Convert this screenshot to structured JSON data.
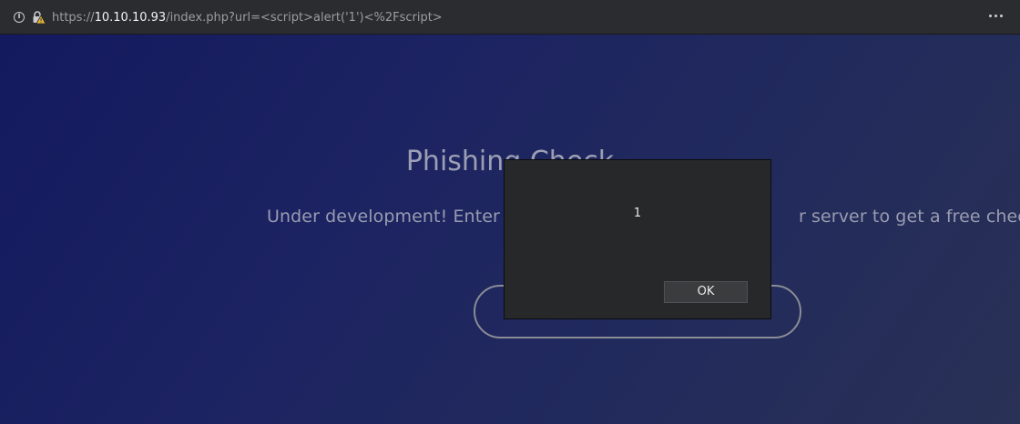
{
  "browser": {
    "url": {
      "scheme": "https://",
      "host": "10.10.10.93",
      "path": "/index.php?url=<script>alert('1')<%2Fscript>"
    },
    "icons": {
      "info": "info-icon",
      "security": "warning-lock-icon",
      "menu": "more-actions-icon"
    }
  },
  "page": {
    "heading": "Phishing Check",
    "subtitle_visible_left": "Under development! Enter",
    "subtitle_visible_right": "r server to get a free check."
  },
  "alert": {
    "message": "1",
    "ok_label": "OK"
  },
  "colors": {
    "urlbar_bg": "#2b2c30",
    "page_gradient_start": "#131a5e",
    "page_gradient_end": "#2a3156",
    "dialog_bg": "#262829",
    "lock_warning": "#e6b437"
  }
}
